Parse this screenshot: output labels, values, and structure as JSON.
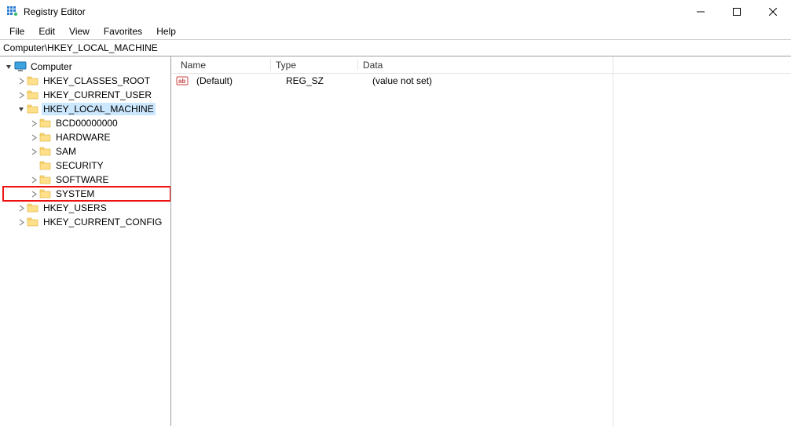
{
  "app": {
    "title": "Registry Editor"
  },
  "menu": {
    "items": [
      "File",
      "Edit",
      "View",
      "Favorites",
      "Help"
    ]
  },
  "address": {
    "value": "Computer\\HKEY_LOCAL_MACHINE"
  },
  "tree": {
    "root": {
      "label": "Computer",
      "expanded": true,
      "children": [
        {
          "label": "HKEY_CLASSES_ROOT",
          "expandable": true
        },
        {
          "label": "HKEY_CURRENT_USER",
          "expandable": true
        },
        {
          "label": "HKEY_LOCAL_MACHINE",
          "expandable": true,
          "expanded": true,
          "selected": true,
          "children": [
            {
              "label": "BCD00000000",
              "expandable": true
            },
            {
              "label": "HARDWARE",
              "expandable": true
            },
            {
              "label": "SAM",
              "expandable": true
            },
            {
              "label": "SECURITY",
              "expandable": false
            },
            {
              "label": "SOFTWARE",
              "expandable": true
            },
            {
              "label": "SYSTEM",
              "expandable": true,
              "highlighted": true
            }
          ]
        },
        {
          "label": "HKEY_USERS",
          "expandable": true
        },
        {
          "label": "HKEY_CURRENT_CONFIG",
          "expandable": true
        }
      ]
    }
  },
  "list": {
    "columns": {
      "name": "Name",
      "type": "Type",
      "data": "Data"
    },
    "rows": [
      {
        "name": "(Default)",
        "type": "REG_SZ",
        "data": "(value not set)"
      }
    ]
  }
}
